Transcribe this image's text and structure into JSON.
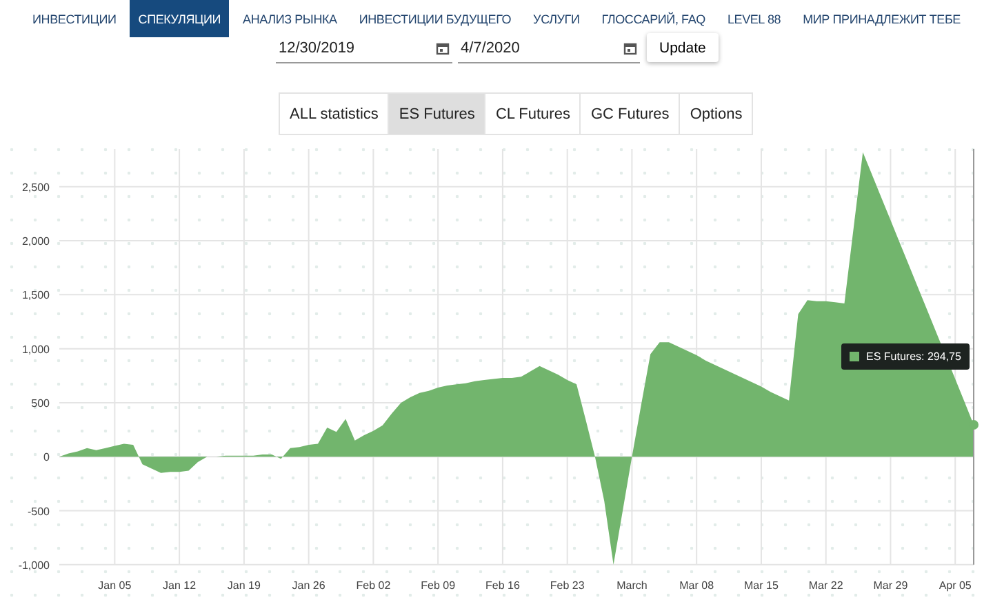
{
  "nav": {
    "items": [
      {
        "label": "ИНВЕСТИЦИИ",
        "selected": false
      },
      {
        "label": "СПЕКУЛЯЦИИ",
        "selected": true
      },
      {
        "label": "АНАЛИЗ РЫНКА",
        "selected": false
      },
      {
        "label": "ИНВЕСТИЦИИ БУДУЩЕГО",
        "selected": false
      },
      {
        "label": "УСЛУГИ",
        "selected": false
      },
      {
        "label": "ГЛОССАРИЙ, FAQ",
        "selected": false
      },
      {
        "label": "LEVEL 88",
        "selected": false
      },
      {
        "label": "МИР ПРИНАДЛЕЖИТ ТЕБЕ",
        "selected": false
      }
    ]
  },
  "filters": {
    "start_date": "12/30/2019",
    "end_date": "4/7/2020",
    "button": "Update"
  },
  "tabs": [
    {
      "label": "ALL statistics",
      "selected": false
    },
    {
      "label": "ES Futures",
      "selected": true
    },
    {
      "label": "CL Futures",
      "selected": false
    },
    {
      "label": "GC Futures",
      "selected": false
    },
    {
      "label": "Options",
      "selected": false
    }
  ],
  "chart": {
    "tooltip": {
      "separator": ": ",
      "value": "294,75"
    },
    "chart_data": {
      "type": "area",
      "categories": [
        null,
        null,
        null,
        null,
        null,
        null,
        "Jan 05",
        null,
        null,
        null,
        null,
        null,
        null,
        "Jan 12",
        null,
        null,
        null,
        null,
        null,
        null,
        "Jan 19",
        null,
        null,
        null,
        null,
        null,
        null,
        "Jan 26",
        null,
        null,
        null,
        null,
        null,
        null,
        "Feb 02",
        null,
        null,
        null,
        null,
        null,
        null,
        "Feb 09",
        null,
        null,
        null,
        null,
        null,
        null,
        "Feb 16",
        null,
        null,
        null,
        null,
        null,
        null,
        "Feb 23",
        null,
        null,
        null,
        null,
        null,
        null,
        "March",
        null,
        null,
        null,
        null,
        null,
        null,
        "Mar 08",
        null,
        null,
        null,
        null,
        null,
        null,
        "Mar 15",
        null,
        null,
        null,
        null,
        null,
        null,
        "Mar 22",
        null,
        null,
        null,
        null,
        null,
        null,
        "Mar 29",
        null,
        null,
        null,
        null,
        null,
        null,
        "Apr 05",
        null,
        null
      ],
      "series": [
        {
          "name": "ES Futures",
          "color": "#72b56d",
          "values": [
            0,
            30,
            50,
            80,
            60,
            80,
            100,
            120,
            110,
            -70,
            -110,
            -150,
            -140,
            -140,
            -130,
            -50,
            0,
            0,
            10,
            10,
            10,
            10,
            20,
            20,
            -20,
            80,
            90,
            110,
            120,
            270,
            230,
            350,
            150,
            200,
            240,
            290,
            400,
            500,
            550,
            590,
            610,
            640,
            660,
            670,
            680,
            700,
            710,
            720,
            730,
            730,
            740,
            790,
            840,
            800,
            760,
            710,
            670,
            340,
            0,
            -410,
            -1000,
            -500,
            0,
            480,
            950,
            1060,
            1060,
            1020,
            980,
            940,
            890,
            850,
            810,
            770,
            730,
            690,
            650,
            600,
            560,
            520,
            1320,
            1450,
            1440,
            1440,
            1430,
            1420,
            2120,
            2820,
            2610,
            2400,
            2190,
            1980,
            1770,
            1560,
            1350,
            1140,
            null,
            720,
            510,
            295
          ]
        }
      ],
      "ylim": [
        -1000,
        2850
      ],
      "grid": true,
      "yticks": [
        {
          "value": -1000,
          "label": "-1,000"
        },
        {
          "value": -500,
          "label": "-500"
        },
        {
          "value": 0,
          "label": "0"
        },
        {
          "value": 500,
          "label": "500"
        },
        {
          "value": 1000,
          "label": "1,000"
        },
        {
          "value": 1500,
          "label": "1,500"
        },
        {
          "value": 2000,
          "label": "2,000"
        },
        {
          "value": 2500,
          "label": "2,500"
        }
      ]
    }
  }
}
